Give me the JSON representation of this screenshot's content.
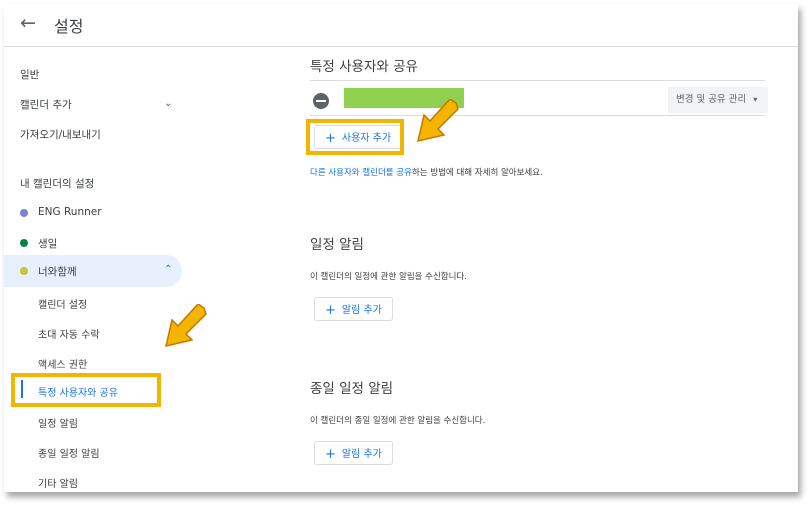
{
  "header": {
    "title": "설정"
  },
  "sidebar": {
    "items": [
      {
        "label": "일반"
      },
      {
        "label": "캘린더 추가"
      },
      {
        "label": "가져오기/내보내기"
      }
    ],
    "section_title": "내 캘린더의 설정",
    "calendars": [
      {
        "label": "ENG Runner",
        "color": "#7986cb"
      },
      {
        "label": "생일",
        "color": "#0b8043"
      },
      {
        "label": "너와함께",
        "color": "#c0ca33"
      }
    ],
    "sub_items": [
      {
        "label": "캘린더 설정"
      },
      {
        "label": "초대 자동 수락"
      },
      {
        "label": "액세스 권한"
      },
      {
        "label": "특정 사용자와 공유"
      },
      {
        "label": "일정 알림"
      },
      {
        "label": "종일 일정 알림"
      },
      {
        "label": "기타 알림"
      }
    ]
  },
  "main": {
    "share": {
      "title": "특정 사용자와 공유",
      "manage_select": "변경 및 공유 관리",
      "add_user": "사용자 추가",
      "note_link1": "다른 사용자와 캘린더를 공유",
      "note_rest": "하는 방법에 대해 자세히 알아보세요."
    },
    "event_notifications": {
      "title": "일정 알림",
      "desc": "이 캘린더의 일정에 관한 알림을 수신합니다.",
      "add": "알림 추가"
    },
    "allday_notifications": {
      "title": "종일 일정 알림",
      "desc": "이 캘린더의 종일 일정에 관한 알림을 수신합니다.",
      "add": "알림 추가"
    }
  },
  "colors": {
    "accent": "#1a73e8",
    "highlight": "#f4b400",
    "active_bg": "#e8f0fe"
  }
}
